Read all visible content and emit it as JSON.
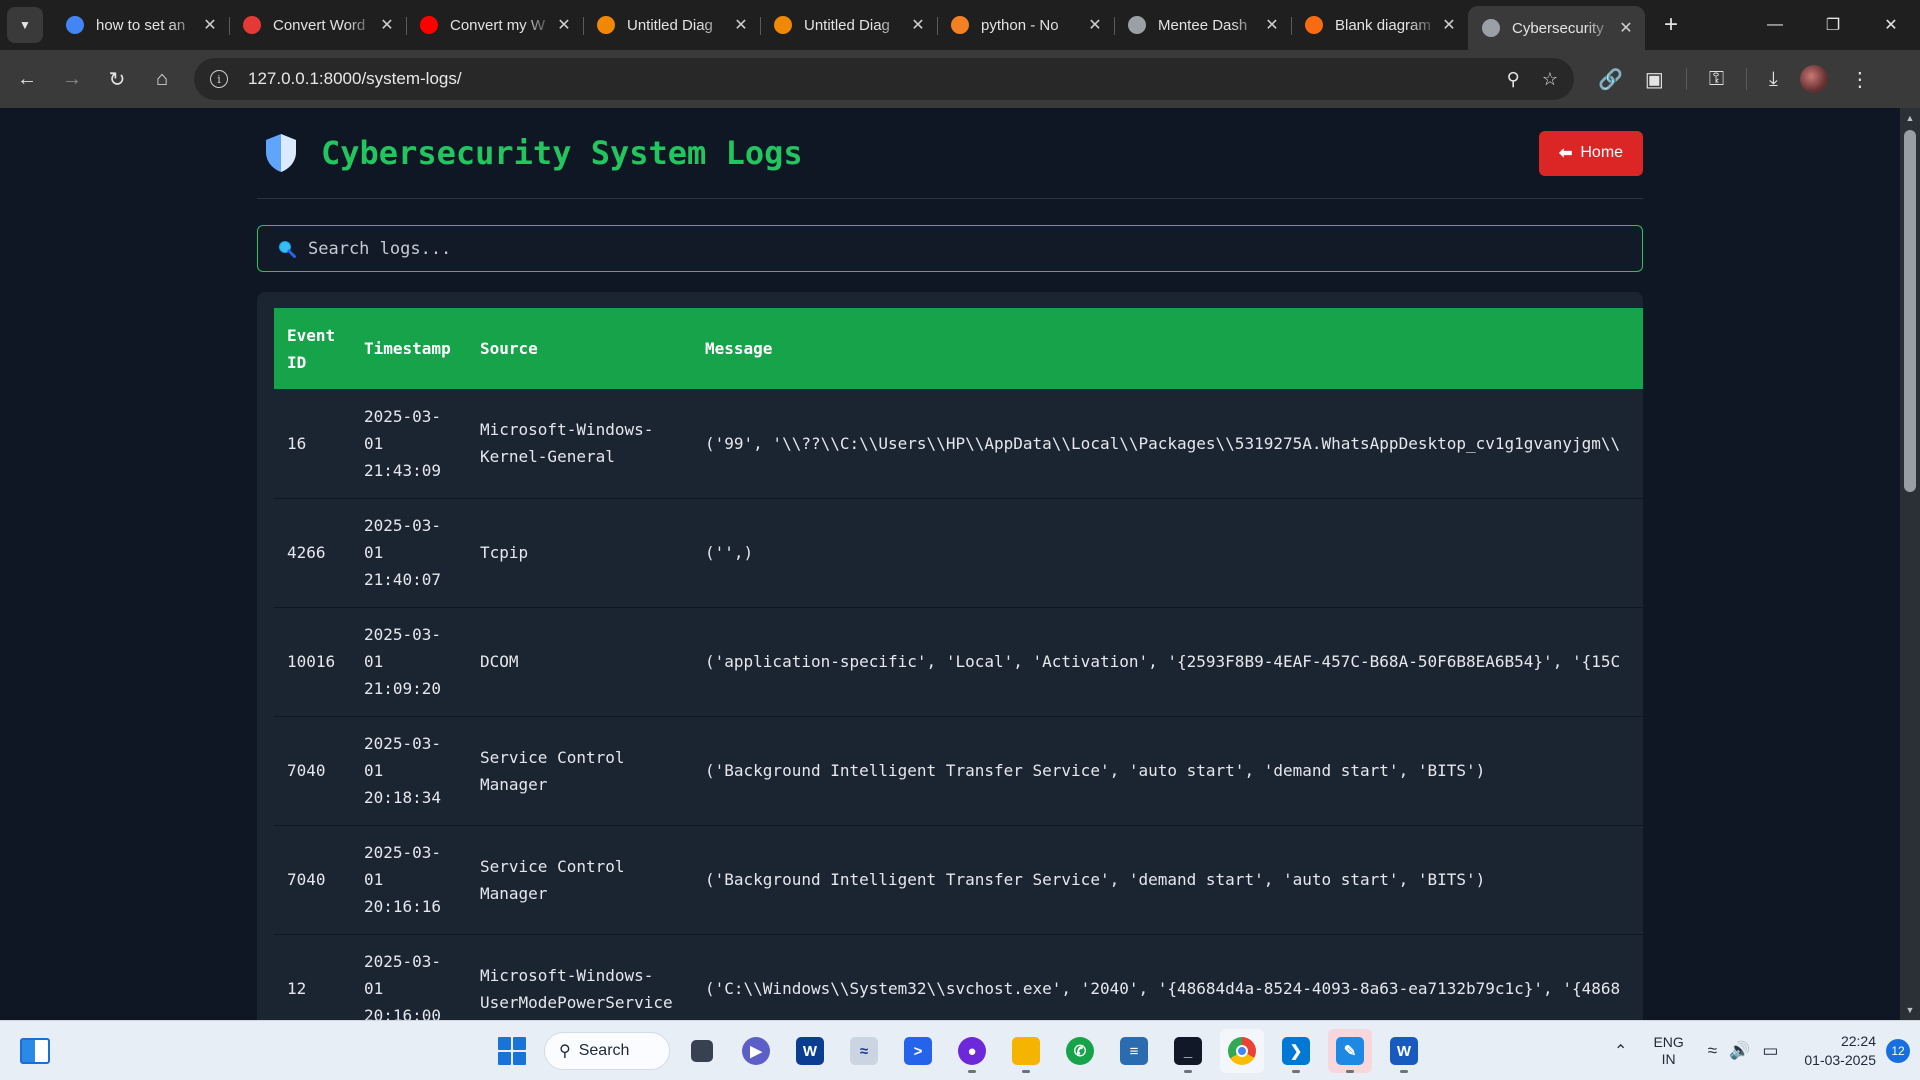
{
  "browser": {
    "tabs": [
      {
        "title": "how to set an",
        "favicon": "google-icon",
        "color": "#4285f4"
      },
      {
        "title": "Convert Word",
        "favicon": "heart-icon",
        "color": "#e53935"
      },
      {
        "title": "Convert my W",
        "favicon": "youtube-icon",
        "color": "#ff0000"
      },
      {
        "title": "Untitled Diag",
        "favicon": "drawio-icon",
        "color": "#f08705"
      },
      {
        "title": "Untitled Diag",
        "favicon": "drawio-icon",
        "color": "#f08705"
      },
      {
        "title": "python - No",
        "favicon": "stackoverflow-icon",
        "color": "#f48024"
      },
      {
        "title": "Mentee Dash",
        "favicon": "globe-icon",
        "color": "#9aa0a6"
      },
      {
        "title": "Blank diagram",
        "favicon": "lucidchart-icon",
        "color": "#f96b13"
      },
      {
        "title": "Cybersecurity",
        "favicon": "globe-icon",
        "color": "#9aa0a6",
        "active": true
      }
    ],
    "url": "127.0.0.1:8000/system-logs/"
  },
  "page": {
    "title": "Cybersecurity System Logs",
    "home_label": "Home",
    "search_placeholder": "Search logs...",
    "accent": "#22c55e",
    "danger": "#dc2626"
  },
  "table": {
    "headers": [
      "Event ID",
      "Timestamp",
      "Source",
      "Message"
    ],
    "rows": [
      {
        "event_id": "16",
        "timestamp": "2025-03-01 21:43:09",
        "source": "Microsoft-Windows-Kernel-General",
        "message": "('99', '\\\\??\\\\C:\\\\Users\\\\HP\\\\AppData\\\\Local\\\\Packages\\\\5319275A.WhatsAppDesktop_cv1g1gvanyjgm\\\\"
      },
      {
        "event_id": "4266",
        "timestamp": "2025-03-01 21:40:07",
        "source": "Tcpip",
        "message": "('',)"
      },
      {
        "event_id": "10016",
        "timestamp": "2025-03-01 21:09:20",
        "source": "DCOM",
        "message": "('application-specific', 'Local', 'Activation', '{2593F8B9-4EAF-457C-B68A-50F6B8EA6B54}', '{15C"
      },
      {
        "event_id": "7040",
        "timestamp": "2025-03-01 20:18:34",
        "source": "Service Control Manager",
        "message": "('Background Intelligent Transfer Service', 'auto start', 'demand start', 'BITS')"
      },
      {
        "event_id": "7040",
        "timestamp": "2025-03-01 20:16:16",
        "source": "Service Control Manager",
        "message": "('Background Intelligent Transfer Service', 'demand start', 'auto start', 'BITS')"
      },
      {
        "event_id": "12",
        "timestamp": "2025-03-01 20:16:00",
        "source": "Microsoft-Windows-UserModePowerService",
        "message": "('C:\\\\Windows\\\\System32\\\\svchost.exe', '2040', '{48684d4a-8524-4093-8a63-ea7132b79c1c}', '{4868"
      }
    ]
  },
  "taskbar": {
    "search_label": "Search",
    "language": "ENG",
    "region": "IN",
    "time": "22:24",
    "date": "01-03-2025",
    "notifications": "12"
  }
}
